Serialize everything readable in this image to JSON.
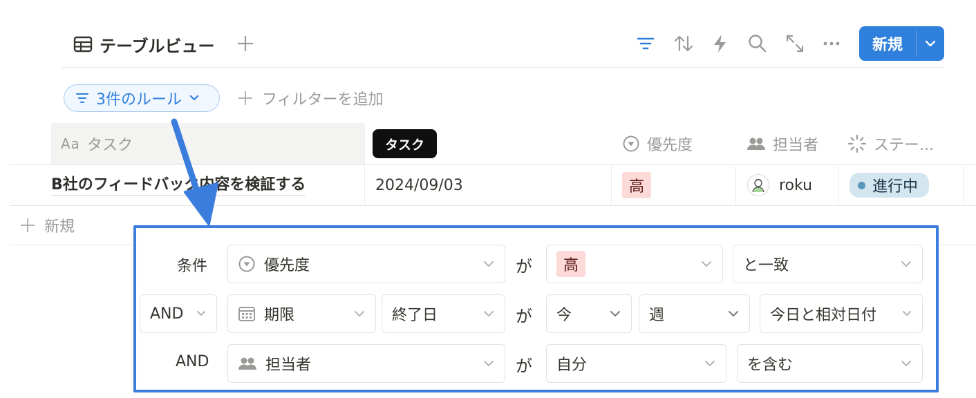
{
  "toolbar": {
    "view_label": "テーブルビュー",
    "icons": [
      "table-icon",
      "plus-icon",
      "filter-icon",
      "sort-icon",
      "lightning-icon",
      "search-icon",
      "expand-icon",
      "more-icon"
    ],
    "new_button_label": "新規"
  },
  "filter_bar": {
    "rules_label": "3件のルール",
    "add_filter_label": "フィルターを追加"
  },
  "table": {
    "tooltip": "タスク",
    "headers": {
      "task": {
        "prefix": "Aa",
        "label": "タスク"
      },
      "priority": "優先度",
      "assignee": "担当者",
      "status": "ステー..."
    },
    "rows": [
      {
        "task": "B社のフィードバック内容を検証する",
        "date": "2024/09/03",
        "priority": "高",
        "assignee": "roku",
        "status": "進行中"
      }
    ],
    "new_row_label": "新規"
  },
  "filter_panel": {
    "rules": [
      {
        "connector": "条件",
        "property": "優先度",
        "verb": "が",
        "value": "高",
        "operator": "と一致"
      },
      {
        "connector": "AND",
        "property": "期限",
        "date_kind": "終了日",
        "verb": "が",
        "value1": "今",
        "value2": "週",
        "operator": "今日と相対日付"
      },
      {
        "connector": "AND",
        "property": "担当者",
        "verb": "が",
        "value": "自分",
        "operator": "を含む"
      }
    ]
  },
  "colors": {
    "accent": "#2f7fdc",
    "panel_border": "#3a7ddc",
    "high_tag_bg": "#fbdad7",
    "status_bg": "#d3e5ef"
  }
}
